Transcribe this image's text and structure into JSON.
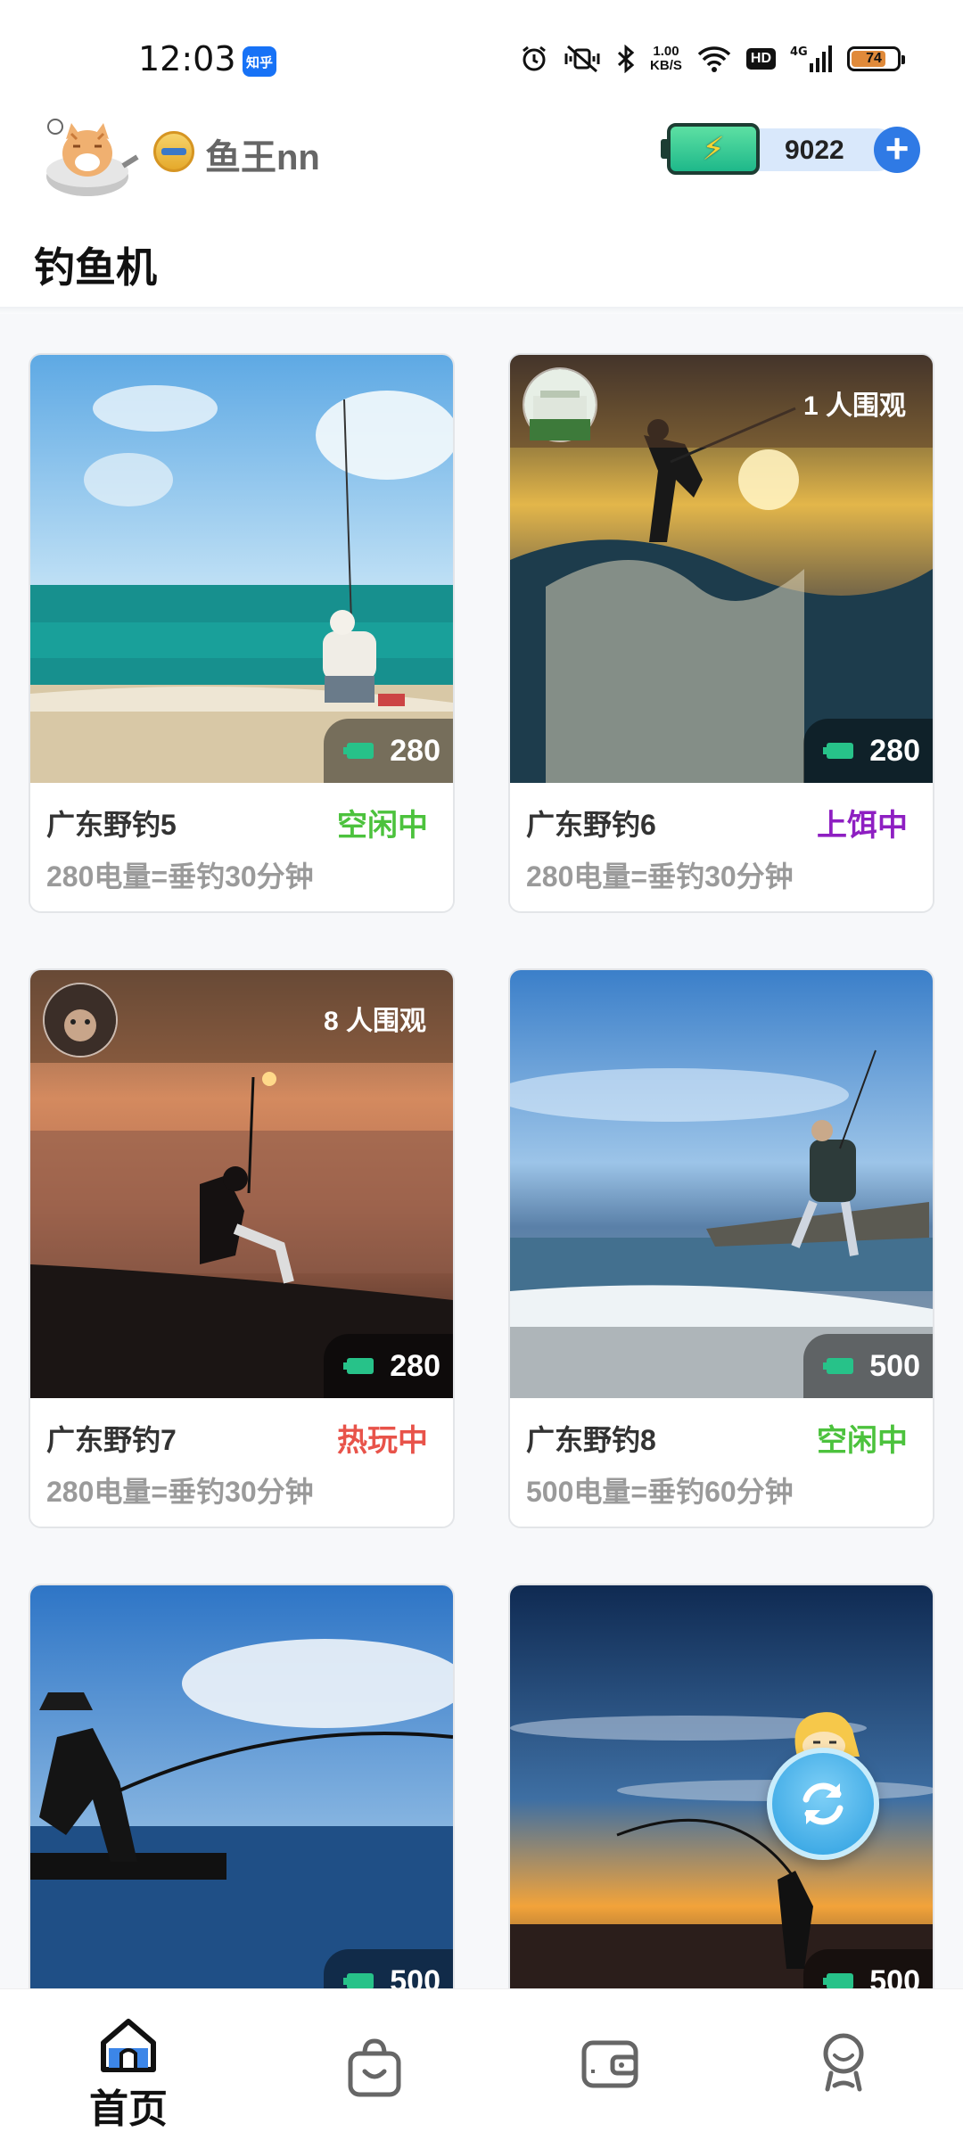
{
  "status_bar": {
    "time": "12:03",
    "app_badge": "知乎",
    "net_speed_value": "1.00",
    "net_speed_unit": "KB/S",
    "hd_label": "HD",
    "signal_label": "4G",
    "battery_level": "74"
  },
  "header": {
    "username": "鱼王nn",
    "energy_value": "9022",
    "add_symbol": "+"
  },
  "page": {
    "title": "钓鱼机"
  },
  "cards": [
    {
      "name": "广东野钓5",
      "status": "空闲中",
      "status_color": "#4cc23d",
      "desc": "280电量=垂钓30分钟",
      "power": "280",
      "watchers": ""
    },
    {
      "name": "广东野钓6",
      "status": "上饵中",
      "status_color": "#8e1fc2",
      "desc": "280电量=垂钓30分钟",
      "power": "280",
      "watchers": "1 人围观"
    },
    {
      "name": "广东野钓7",
      "status": "热玩中",
      "status_color": "#e8534a",
      "desc": "280电量=垂钓30分钟",
      "power": "280",
      "watchers": "8 人围观"
    },
    {
      "name": "广东野钓8",
      "status": "空闲中",
      "status_color": "#4cc23d",
      "desc": "500电量=垂钓60分钟",
      "power": "500",
      "watchers": ""
    },
    {
      "name": "",
      "status": "",
      "desc": "",
      "power": "500",
      "watchers": ""
    },
    {
      "name": "",
      "status": "",
      "desc": "",
      "power": "500",
      "watchers": ""
    }
  ],
  "bottom_nav": {
    "home_label": "首页"
  }
}
